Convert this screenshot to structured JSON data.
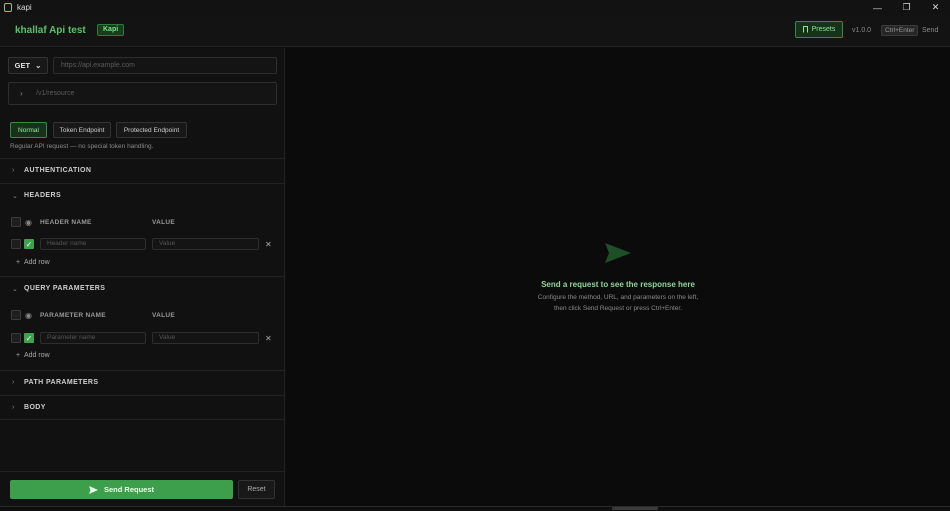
{
  "window": {
    "title": "kapi",
    "minimize": "—",
    "maximize": "❐",
    "close": "✕"
  },
  "header": {
    "brand": "khallaf Api test",
    "badge": "Kapi",
    "presets_label": "Presets",
    "version": "v1.0.0",
    "shortcut": "Ctrl+Enter",
    "shortcut_action": "Send"
  },
  "request": {
    "method": "GET",
    "url_placeholder": "https://api.example.com",
    "path_placeholder": "/v1/resource",
    "modes": [
      "Normal",
      "Token Endpoint",
      "Protected Endpoint"
    ],
    "active_mode": "Normal",
    "mode_description": "Regular API request — no special token handling."
  },
  "sections": {
    "authentication": "AUTHENTICATION",
    "headers": "HEADERS",
    "query_parameters": "QUERY PARAMETERS",
    "path_parameters": "PATH PARAMETERS",
    "body": "BODY"
  },
  "headers_table": {
    "col_name": "HEADER NAME",
    "col_value": "VALUE",
    "name_placeholder": "Header name",
    "value_placeholder": "Value",
    "add_row": "Add row"
  },
  "query_table": {
    "col_name": "PARAMETER NAME",
    "col_value": "VALUE",
    "name_placeholder": "Parameter name",
    "value_placeholder": "Value",
    "add_row": "Add row"
  },
  "footer": {
    "send_label": "Send Request",
    "reset_label": "Reset"
  },
  "response": {
    "title": "Send a request to see the response here",
    "line1": "Configure the method, URL, and parameters on the left,",
    "line2": "then click Send Request or press Ctrl+Enter."
  },
  "colors": {
    "accent": "#3d9e4b",
    "brand_text": "#5cc06a",
    "background": "#0d0d0d"
  }
}
